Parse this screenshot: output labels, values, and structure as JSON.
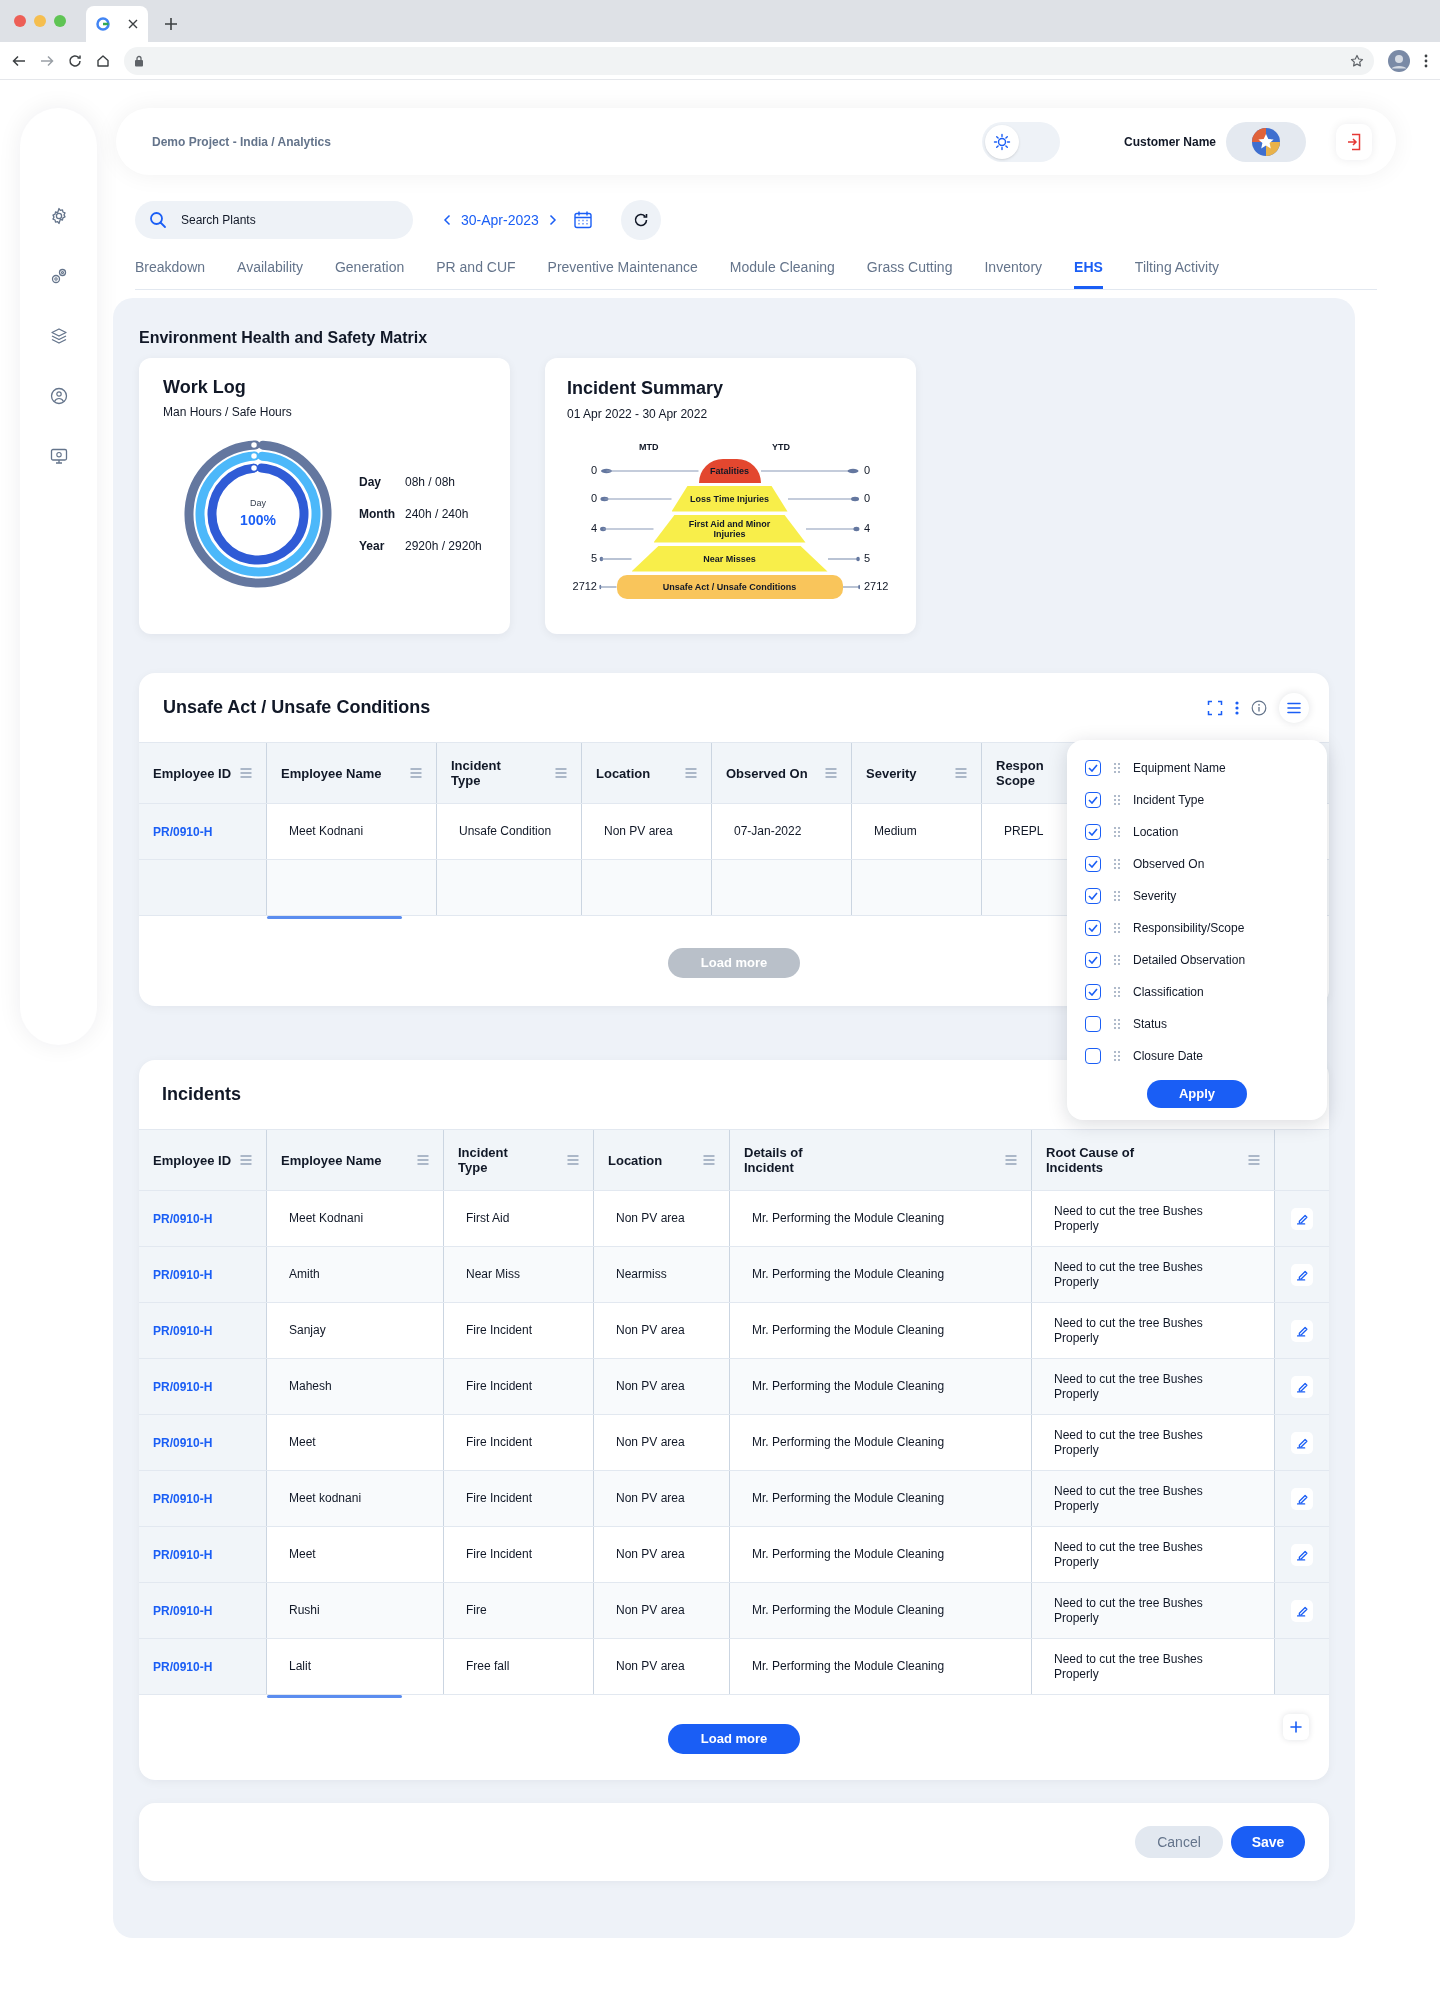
{
  "breadcrumb": "Demo Project - India / Analytics",
  "theme_toggle": {
    "on": false
  },
  "user": {
    "name": "Customer Name"
  },
  "search": {
    "placeholder": "Search Plants"
  },
  "date": "30-Apr-2023",
  "tabs": [
    {
      "label": "Breakdown",
      "selected": false
    },
    {
      "label": "Availability",
      "selected": false
    },
    {
      "label": "Generation",
      "selected": false
    },
    {
      "label": "PR and CUF",
      "selected": false
    },
    {
      "label": "Preventive Maintenance",
      "selected": false
    },
    {
      "label": "Module Cleaning",
      "selected": false
    },
    {
      "label": "Grass Cutting",
      "selected": false
    },
    {
      "label": "Inventory",
      "selected": false
    },
    {
      "label": "EHS",
      "selected": true
    },
    {
      "label": "Tilting Activity",
      "selected": false
    }
  ],
  "section_title": "Environment Health and Safety Matrix",
  "work_log": {
    "title": "Work Log",
    "subtitle": "Man Hours / Safe Hours",
    "center_label": "Day",
    "center_value": "100%",
    "rings": [
      {
        "color": "#64779f"
      },
      {
        "color": "#4cb8fa"
      },
      {
        "color": "#2f5bd6"
      }
    ],
    "stats": [
      {
        "label": "Day",
        "value": "08h / 08h"
      },
      {
        "label": "Month",
        "value": "240h / 240h"
      },
      {
        "label": "Year",
        "value": "2920h / 2920h"
      }
    ]
  },
  "incident_summary": {
    "title": "Incident Summary",
    "subtitle": "01 Apr 2022 - 30 Apr 2022",
    "mtd_label": "MTD",
    "ytd_label": "YTD",
    "levels": [
      {
        "label": "Fatalities",
        "mtd": "0",
        "ytd": "0",
        "color": "#e3472f"
      },
      {
        "label": "Loss Time Injuries",
        "mtd": "0",
        "ytd": "0",
        "color": "#f8ee4a"
      },
      {
        "label": "First Aid and Minor Injuries",
        "mtd": "4",
        "ytd": "4",
        "color": "#f8ee4a"
      },
      {
        "label": "Near Misses",
        "mtd": "5",
        "ytd": "5",
        "color": "#f8ee4a"
      },
      {
        "label": "Unsafe Act / Unsafe Conditions",
        "mtd": "2712",
        "ytd": "2712",
        "color": "#f9c55b"
      }
    ]
  },
  "unsafe": {
    "title": "Unsafe Act / Unsafe Conditions",
    "columns": [
      {
        "label": "Employee ID",
        "has_menu": true
      },
      {
        "label": "Employee Name",
        "has_menu": true
      },
      {
        "label": "Incident Type",
        "has_menu": true
      },
      {
        "label": "Location",
        "has_menu": true
      },
      {
        "label": "Observed On",
        "has_menu": true
      },
      {
        "label": "Severity",
        "has_menu": true
      },
      {
        "label": "Respon Scope",
        "has_menu": false
      }
    ],
    "rows": [
      {
        "cells": [
          "PR/0910-H",
          "Meet Kodnani",
          "Unsafe Condition",
          "Non PV area",
          "07-Jan-2022",
          "Medium",
          "PREPL"
        ]
      }
    ],
    "load_more": {
      "label": "Load more",
      "disabled": true
    }
  },
  "column_menu": {
    "items": [
      {
        "label": "Equipment Name",
        "checked": true
      },
      {
        "label": "Incident Type",
        "checked": true
      },
      {
        "label": "Location",
        "checked": true
      },
      {
        "label": "Observed On",
        "checked": true
      },
      {
        "label": "Severity",
        "checked": true
      },
      {
        "label": "Responsibility/Scope",
        "checked": true
      },
      {
        "label": "Detailed Observation",
        "checked": true
      },
      {
        "label": "Classification",
        "checked": true
      },
      {
        "label": "Status",
        "checked": false
      },
      {
        "label": "Closure Date",
        "checked": false
      }
    ],
    "apply": "Apply"
  },
  "incidents": {
    "title": "Incidents",
    "columns": [
      {
        "label": "Employee ID",
        "has_menu": true
      },
      {
        "label": "Employee Name",
        "has_menu": true
      },
      {
        "label": "Incident Type",
        "has_menu": true
      },
      {
        "label": "Location",
        "has_menu": true
      },
      {
        "label": "Details of Incident",
        "has_menu": true
      },
      {
        "label": "Root Cause of Incidents",
        "has_menu": true
      }
    ],
    "rows": [
      {
        "cells": [
          "PR/0910-H",
          "Meet Kodnani",
          "First Aid",
          "Non PV area",
          "Mr. Performing the Module Cleaning",
          "Need to cut the tree Bushes Properly"
        ],
        "editable": true
      },
      {
        "cells": [
          "PR/0910-H",
          "Amith",
          "Near Miss",
          "Nearmiss",
          "Mr. Performing the Module Cleaning",
          "Need to cut the tree Bushes Properly"
        ],
        "editable": true
      },
      {
        "cells": [
          "PR/0910-H",
          "Sanjay",
          "Fire Incident",
          "Non PV area",
          "Mr. Performing the Module Cleaning",
          "Need to cut the tree Bushes Properly"
        ],
        "editable": true
      },
      {
        "cells": [
          "PR/0910-H",
          "Mahesh",
          "Fire Incident",
          "Non PV area",
          "Mr. Performing the Module Cleaning",
          "Need to cut the tree Bushes Properly"
        ],
        "editable": true
      },
      {
        "cells": [
          "PR/0910-H",
          "Meet",
          "Fire Incident",
          "Non PV area",
          "Mr. Performing the Module Cleaning",
          "Need to cut the tree Bushes Properly"
        ],
        "editable": true
      },
      {
        "cells": [
          "PR/0910-H",
          "Meet kodnani",
          "Fire Incident",
          "Non PV area",
          "Mr. Performing the Module Cleaning",
          "Need to cut the tree Bushes Properly"
        ],
        "editable": true
      },
      {
        "cells": [
          "PR/0910-H",
          "Meet",
          "Fire Incident",
          "Non PV area",
          "Mr. Performing the Module Cleaning",
          "Need to cut the tree Bushes Properly"
        ],
        "editable": true
      },
      {
        "cells": [
          "PR/0910-H",
          "Rushi",
          "Fire",
          "Non PV area",
          "Mr. Performing the Module Cleaning",
          "Need to cut the tree Bushes Properly"
        ],
        "editable": true
      },
      {
        "cells": [
          "PR/0910-H",
          "Lalit",
          "Free fall",
          "Non PV area",
          "Mr. Performing the Module Cleaning",
          "Need to cut the tree Bushes Properly"
        ],
        "editable": false
      }
    ],
    "load_more": {
      "label": "Load more",
      "disabled": false
    }
  },
  "footer": {
    "cancel": "Cancel",
    "save": "Save"
  }
}
